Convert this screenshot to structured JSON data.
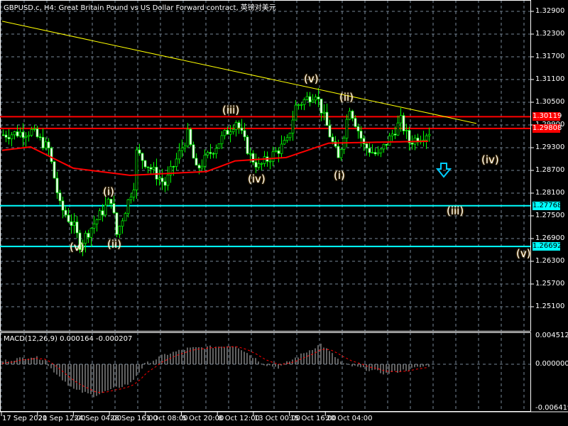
{
  "header": {
    "title": "GBPUSD.c, H4:  Great Britain Pound vs US Dollar Forward contract, 英镑对美元"
  },
  "macd": {
    "label": "MACD(12,26,9) 0.000164 -0.000207",
    "scale": [
      "0.004512",
      "0.000000",
      "-0.006419"
    ]
  },
  "price_axis": [
    "1.32900",
    "1.32300",
    "1.31700",
    "1.31100",
    "1.30500",
    "1.29900",
    "1.29300",
    "1.28700",
    "1.28100",
    "1.27500",
    "1.26900",
    "1.26300",
    "1.25700",
    "1.25100"
  ],
  "levels": [
    {
      "price": "1.30119",
      "color": "#ff0000"
    },
    {
      "price": "1.29808",
      "color": "#ff0000"
    },
    {
      "price": "1.27768",
      "color": "#00ffff"
    },
    {
      "price": "1.26692",
      "color": "#00ffff"
    }
  ],
  "dates": [
    "17 Sep 2020",
    "21 Sep 12:00",
    "24 Sep 04:00",
    "28 Sep 16:00",
    "1 Oct 08:00",
    "5 Oct 20:00",
    "8 Oct 12:00",
    "13 Oct 00:00",
    "15 Oct 16:00",
    "20 Oct 04:00"
  ],
  "waves": [
    "(v)",
    "(ii)",
    "(i)",
    "(iii)",
    "(iv)",
    "(v)",
    "(ii)",
    "(i)",
    "(iv)",
    "(iii)",
    "(v)"
  ],
  "chart_data": {
    "type": "candlestick",
    "symbol": "GBPUSD.c",
    "timeframe": "H4",
    "ylim": [
      1.248,
      1.332
    ],
    "close_path": [
      [
        0,
        1.2964
      ],
      [
        10,
        1.2973
      ],
      [
        16,
        1.2926
      ],
      [
        20,
        1.2776
      ],
      [
        25,
        1.272
      ],
      [
        27,
        1.2675
      ],
      [
        32,
        1.273
      ],
      [
        38,
        1.2795
      ],
      [
        40,
        1.2701
      ],
      [
        46,
        1.2833
      ],
      [
        47,
        1.2917
      ],
      [
        57,
        1.2833
      ],
      [
        65,
        1.2964
      ],
      [
        68,
        1.287
      ],
      [
        80,
        1.2983
      ],
      [
        82,
        1.3001
      ],
      [
        87,
        1.2908
      ],
      [
        90,
        1.2879
      ],
      [
        100,
        1.2945
      ],
      [
        103,
        1.3039
      ],
      [
        110,
        1.3076
      ],
      [
        115,
        1.2964
      ],
      [
        118,
        1.2898
      ],
      [
        122,
        1.3039
      ],
      [
        127,
        1.2935
      ],
      [
        132,
        1.2908
      ],
      [
        140,
        1.3001
      ],
      [
        143,
        1.2945
      ],
      [
        150,
        1.2973
      ]
    ],
    "ma_path": [
      [
        0,
        1.2923
      ],
      [
        10,
        1.2932
      ],
      [
        25,
        1.2876
      ],
      [
        45,
        1.2857
      ],
      [
        72,
        1.2867
      ],
      [
        82,
        1.2895
      ],
      [
        100,
        1.2904
      ],
      [
        115,
        1.2942
      ],
      [
        150,
        1.2947
      ]
    ],
    "macd_path": [
      [
        0,
        0.0005
      ],
      [
        10,
        0.0012
      ],
      [
        15,
        0.0008
      ],
      [
        16,
        -0.0003
      ],
      [
        25,
        -0.004
      ],
      [
        32,
        -0.005
      ],
      [
        45,
        -0.003
      ],
      [
        50,
        0
      ],
      [
        57,
        0.0015
      ],
      [
        65,
        0.0025
      ],
      [
        82,
        0.003
      ],
      [
        92,
        0
      ],
      [
        97,
        -0.0005
      ],
      [
        105,
        0.0015
      ],
      [
        112,
        0.0032
      ],
      [
        120,
        0
      ],
      [
        125,
        -0.0005
      ],
      [
        135,
        -0.0015
      ],
      [
        150,
        -0.0002
      ]
    ],
    "trendline": [
      [
        0,
        1.3264
      ],
      [
        167,
        1.2994
      ]
    ],
    "macd_range": [
      -0.006419,
      0.004512
    ]
  }
}
